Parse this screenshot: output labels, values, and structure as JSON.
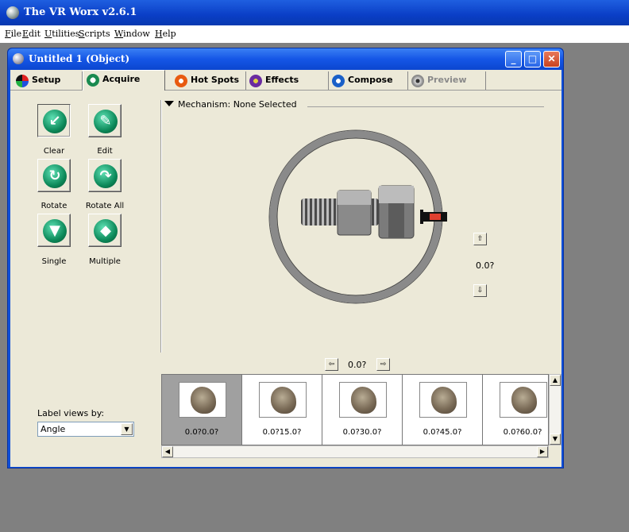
{
  "app": {
    "title": "The VR Worx v2.6.1"
  },
  "menu": [
    "File",
    "Edit",
    "Utilities",
    "Scripts",
    "Window",
    "Help"
  ],
  "document": {
    "title": "Untitled 1 (Object)"
  },
  "tabs": [
    {
      "label": "Setup",
      "state": "normal",
      "icon": "setup-icon"
    },
    {
      "label": "Acquire",
      "state": "active",
      "icon": "acquire-icon"
    },
    {
      "label": "Hot Spots",
      "state": "normal",
      "icon": "hotspots-icon"
    },
    {
      "label": "Effects",
      "state": "normal",
      "icon": "effects-icon"
    },
    {
      "label": "Compose",
      "state": "normal",
      "icon": "compose-icon"
    },
    {
      "label": "Preview",
      "state": "disabled",
      "icon": "preview-icon"
    }
  ],
  "tools": [
    {
      "label": "Clear",
      "icon": "clear-icon"
    },
    {
      "label": "Edit",
      "icon": "edit-icon"
    },
    {
      "label": "Rotate",
      "icon": "rotate-icon"
    },
    {
      "label": "Rotate All",
      "icon": "rotate-all-icon"
    },
    {
      "label": "Single",
      "icon": "single-icon"
    },
    {
      "label": "Multiple",
      "icon": "multiple-icon"
    }
  ],
  "mechanism": {
    "label": "Mechanism: None Selected"
  },
  "pan_angle": "0.0?",
  "tilt_angle": "0.0?",
  "thumbnails": [
    "0.0?0.0?",
    "0.0?15.0?",
    "0.0?30.0?",
    "0.0?45.0?",
    "0.0?60.0?"
  ],
  "label_views": {
    "label": "Label views by:",
    "value": "Angle"
  },
  "colors": {
    "titlebar": "#0a3ec6",
    "panel": "#ece9d8",
    "selected_thumb": "#a0a0a0"
  }
}
